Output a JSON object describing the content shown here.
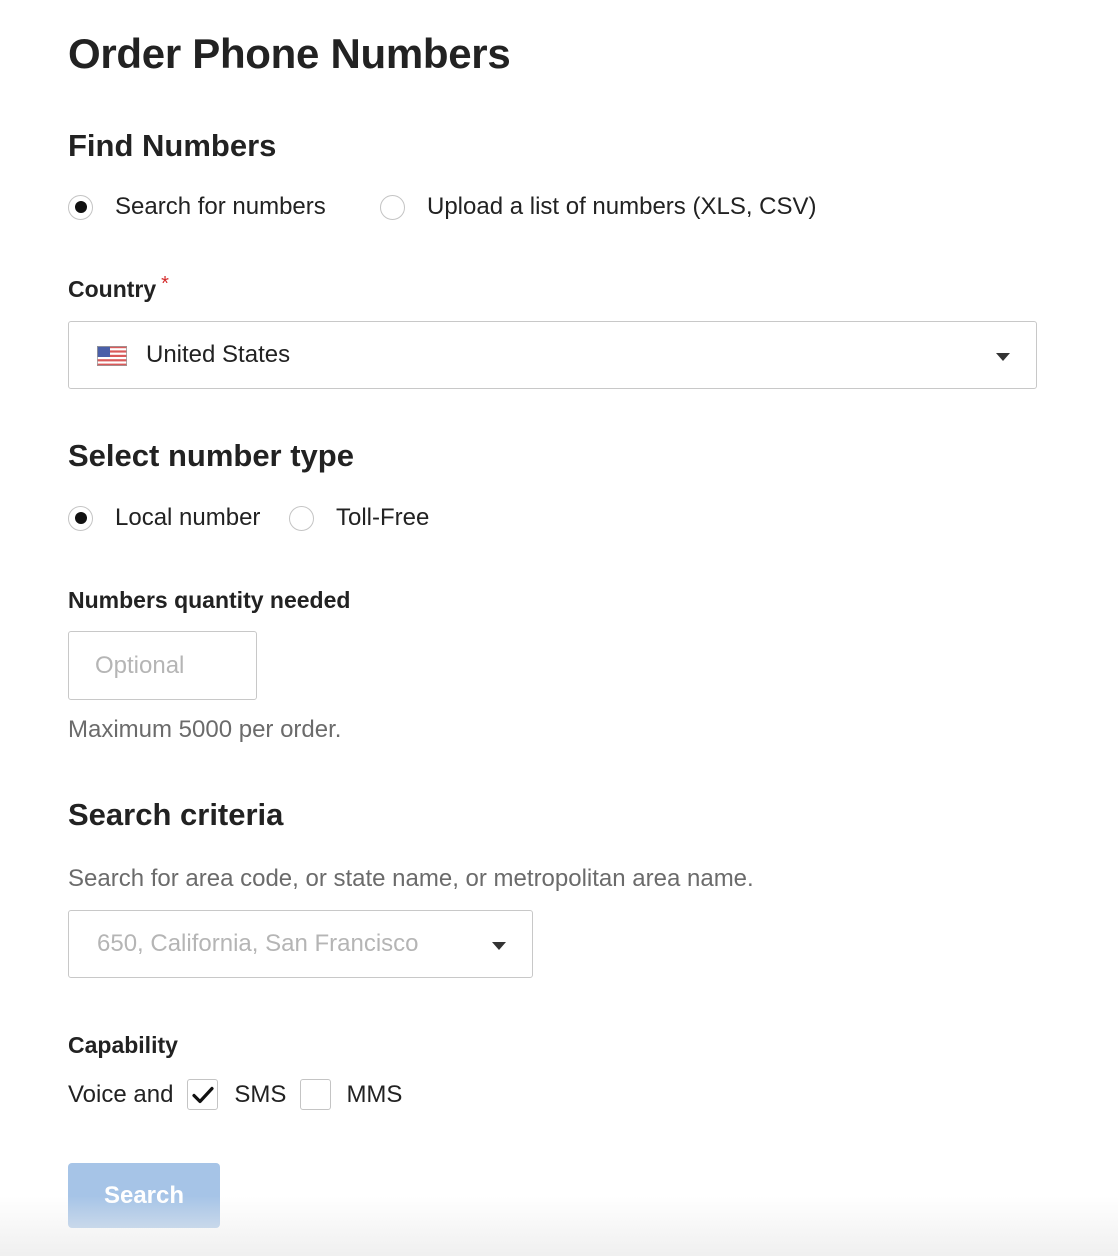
{
  "page": {
    "title": "Order Phone Numbers"
  },
  "find_numbers": {
    "heading": "Find Numbers",
    "options": [
      {
        "label": "Search for numbers",
        "selected": true
      },
      {
        "label": "Upload a list of numbers (XLS, CSV)",
        "selected": false
      }
    ]
  },
  "country": {
    "label": "Country",
    "required_mark": "*",
    "value": "United States",
    "flag_icon": "us-flag-icon"
  },
  "number_type": {
    "heading": "Select number type",
    "options": [
      {
        "label": "Local number",
        "selected": true
      },
      {
        "label": "Toll-Free",
        "selected": false
      }
    ]
  },
  "quantity": {
    "label": "Numbers quantity needed",
    "value": "",
    "placeholder": "Optional",
    "hint": "Maximum 5000 per order."
  },
  "search_criteria": {
    "heading": "Search criteria",
    "description": "Search for area code, or state name, or metropolitan area name.",
    "placeholder": "650, California, San Francisco"
  },
  "capability": {
    "label": "Capability",
    "prefix": "Voice and",
    "options": [
      {
        "label": "SMS",
        "checked": true
      },
      {
        "label": "MMS",
        "checked": false
      }
    ]
  },
  "actions": {
    "search_label": "Search"
  },
  "colors": {
    "button_disabled": "#a6c4e7",
    "required": "#d42a2a",
    "text": "#222222",
    "muted": "#6b6b6b"
  }
}
